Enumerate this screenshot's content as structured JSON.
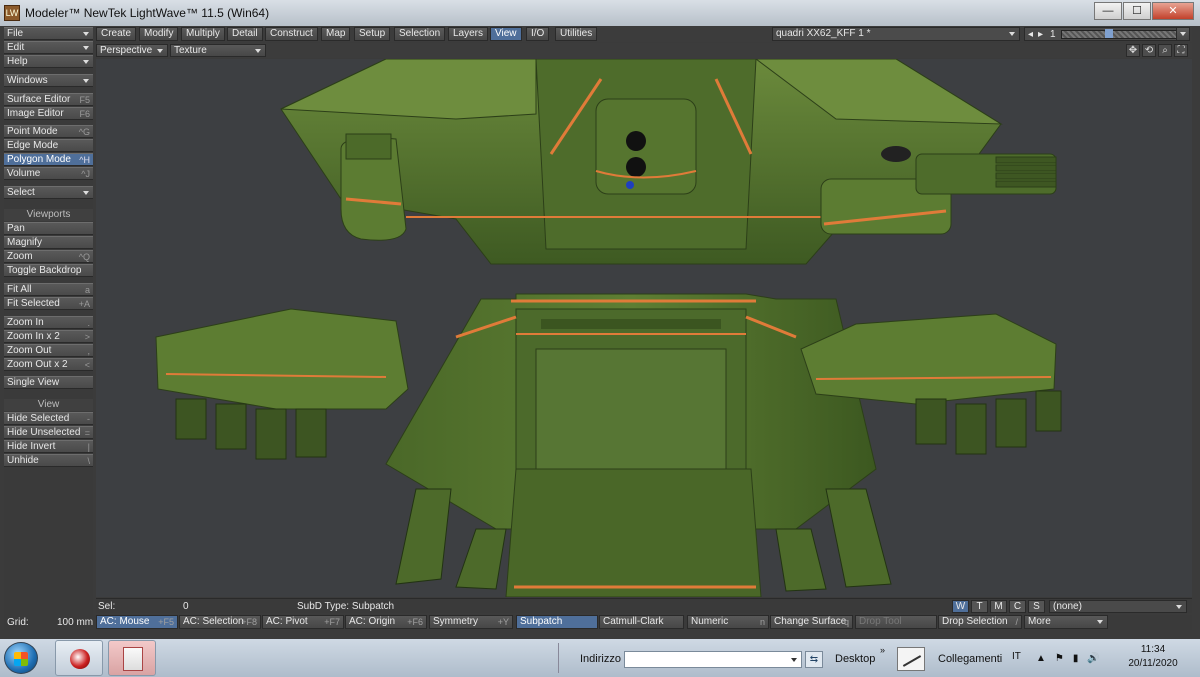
{
  "window": {
    "title": "Modeler™ NewTek LightWave™ 11.5 (Win64)",
    "icon_label": "LW",
    "controls": {
      "minimize": "—",
      "maximize": "☐",
      "close": "✕"
    }
  },
  "sidebar": {
    "menus": [
      {
        "label": "File",
        "dropdown": true
      },
      {
        "label": "Edit",
        "dropdown": true
      },
      {
        "label": "Help",
        "dropdown": true
      }
    ],
    "windows_label": "Windows",
    "editors": [
      {
        "label": "Surface Editor",
        "key": "F5"
      },
      {
        "label": "Image Editor",
        "key": "F6"
      }
    ],
    "modes": [
      {
        "label": "Point Mode",
        "key": "^G",
        "active": false
      },
      {
        "label": "Edge Mode",
        "key": "",
        "active": false
      },
      {
        "label": "Polygon Mode",
        "key": "^H",
        "active": true
      },
      {
        "label": "Volume",
        "key": "^J",
        "active": false
      }
    ],
    "select_label": "Select",
    "viewports_header": "Viewports",
    "viewport_tools": [
      {
        "label": "Pan",
        "key": ""
      },
      {
        "label": "Magnify",
        "key": ""
      },
      {
        "label": "Zoom",
        "key": "^Q"
      },
      {
        "label": "Toggle Backdrop",
        "key": ""
      }
    ],
    "fit_tools": [
      {
        "label": "Fit All",
        "key": "a"
      },
      {
        "label": "Fit Selected",
        "key": "+A"
      }
    ],
    "zoom_tools": [
      {
        "label": "Zoom In",
        "key": "."
      },
      {
        "label": "Zoom In x 2",
        "key": ">"
      },
      {
        "label": "Zoom Out",
        "key": ","
      },
      {
        "label": "Zoom Out x 2",
        "key": "<"
      }
    ],
    "single_view": "Single View",
    "view_header": "View",
    "view_tools": [
      {
        "label": "Hide Selected",
        "key": "-"
      },
      {
        "label": "Hide Unselected",
        "key": "="
      },
      {
        "label": "Hide Invert",
        "key": "|"
      },
      {
        "label": "Unhide",
        "key": "\\"
      }
    ]
  },
  "tabs": [
    "Create",
    "Modify",
    "Multiply",
    "Detail",
    "Construct",
    "Map",
    "Setup",
    "Selection",
    "Layers",
    "View",
    "I/O",
    "Utilities"
  ],
  "active_tab": "View",
  "object_selector": "quadri XX62_KFF 1 *",
  "layer_number": "1",
  "viewport": {
    "projection": "Perspective",
    "render_mode": "Texture",
    "icons": [
      "move-view-icon",
      "rotate-view-icon",
      "zoom-view-icon",
      "maximize-view-icon"
    ]
  },
  "status": {
    "sel_label": "Sel:",
    "sel_value": "0",
    "subd_label": "SubD Type: Subpatch",
    "wtm_buttons": [
      {
        "label": "W",
        "active": true
      },
      {
        "label": "T",
        "active": false
      },
      {
        "label": "M",
        "active": false
      },
      {
        "label": "C",
        "active": false
      },
      {
        "label": "S",
        "active": false
      }
    ],
    "surface_dropdown": "(none)"
  },
  "bottom": {
    "grid_label": "Grid:",
    "grid_value": "100 mm",
    "buttons": [
      {
        "label": "AC: Mouse",
        "key": "+F5",
        "active": true
      },
      {
        "label": "AC: Selection",
        "key": "+F8",
        "active": false
      },
      {
        "label": "AC: Pivot",
        "key": "+F7",
        "active": false
      },
      {
        "label": "AC: Origin",
        "key": "+F6",
        "active": false
      },
      {
        "label": "Symmetry",
        "key": "+Y",
        "active": false
      },
      {
        "label": "Subpatch",
        "key": "",
        "active": true
      },
      {
        "label": "Catmull-Clark",
        "key": "",
        "active": false
      },
      {
        "label": "Numeric",
        "key": "n",
        "active": false
      },
      {
        "label": "Change Surface",
        "key": "q",
        "active": false
      },
      {
        "label": "Drop Tool",
        "key": "",
        "active": false,
        "disabled": true
      },
      {
        "label": "Drop Selection",
        "key": "/",
        "active": false
      },
      {
        "label": "More",
        "key": "",
        "active": false
      }
    ]
  },
  "taskbar": {
    "address_label": "Indirizzo",
    "address_value": "",
    "desktop_label": "Desktop",
    "chevron": "»",
    "links_label": "Collegamenti",
    "language": "IT",
    "tray": [
      "▲",
      "⚑",
      "▮",
      "🔊"
    ],
    "time": "11:34",
    "date": "20/11/2020"
  },
  "colors": {
    "active_blue": "#4f6f9a",
    "viewport_bg": "#3d3f42",
    "mech_green": "#4d6b2c",
    "stripe_orange": "#e07b39"
  }
}
